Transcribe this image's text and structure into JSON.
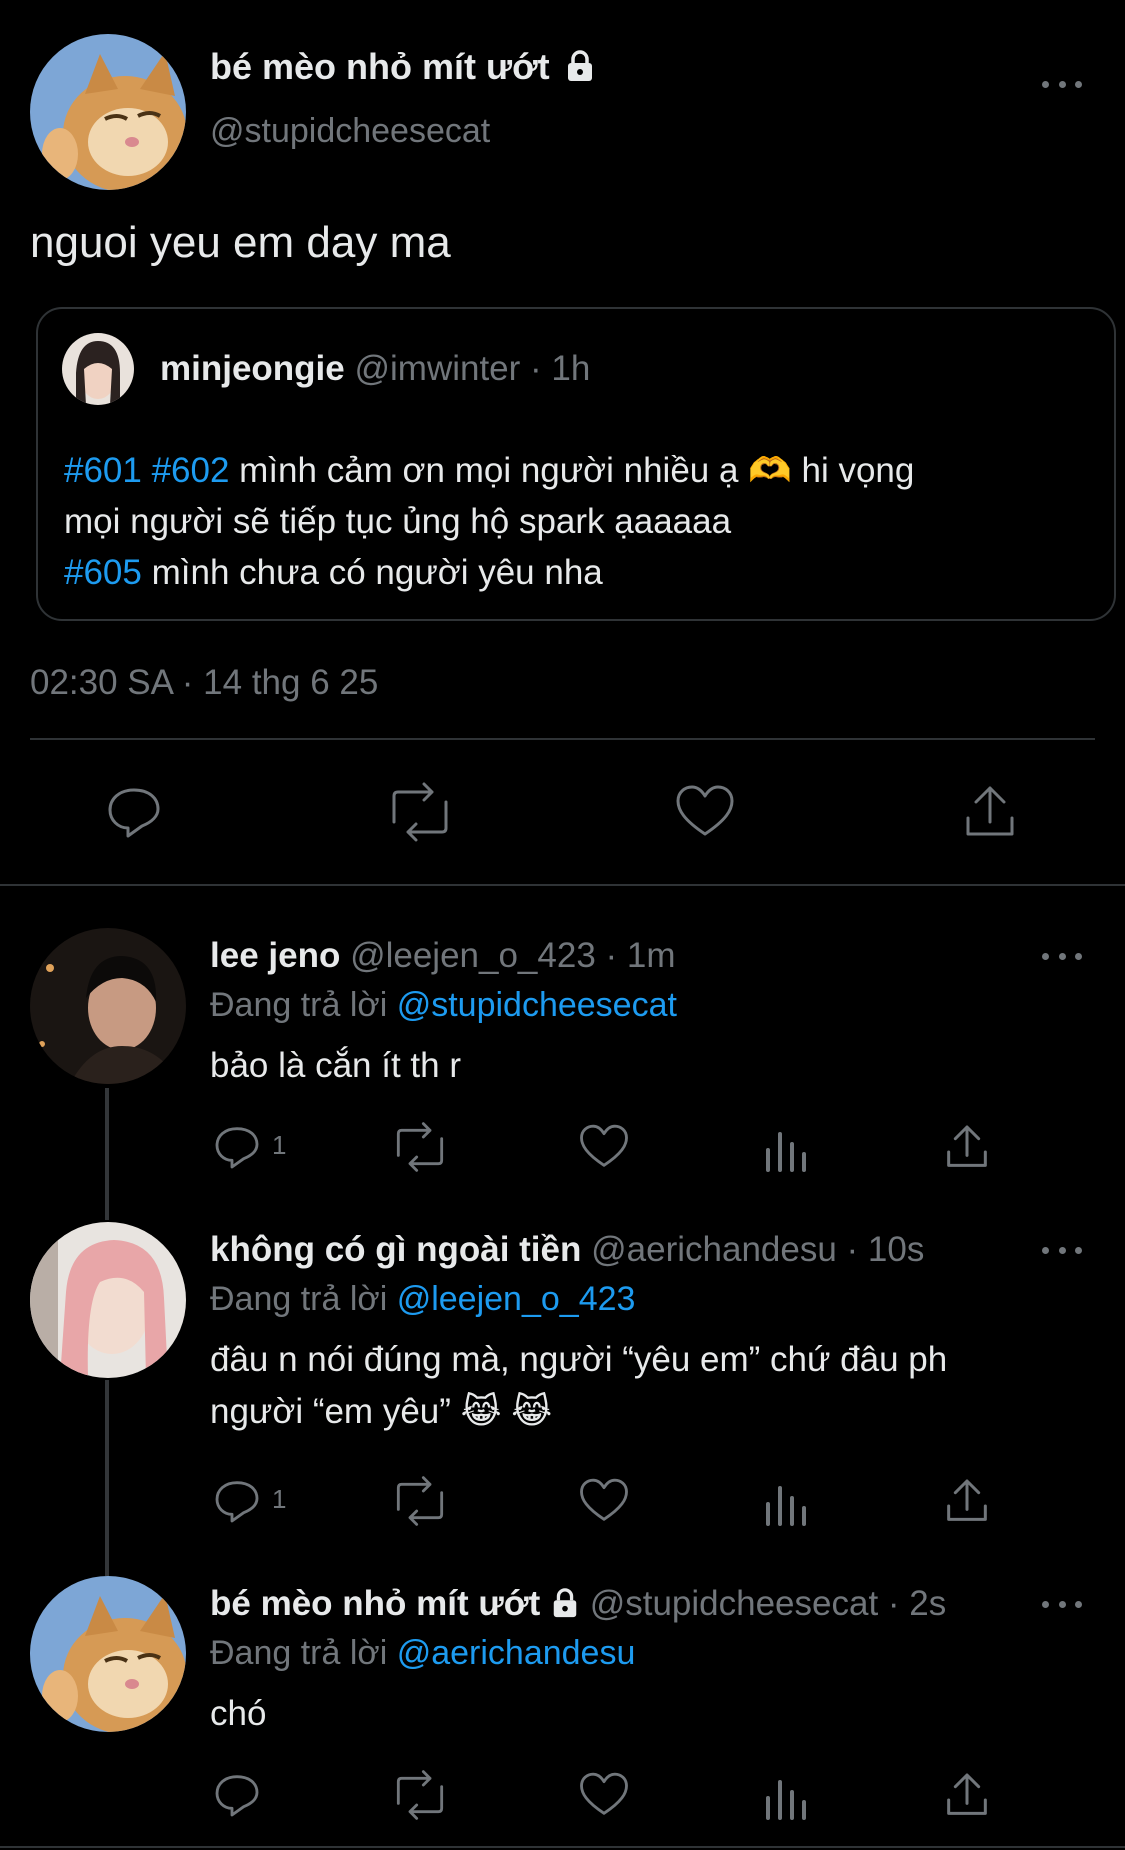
{
  "main_tweet": {
    "display_name": "bé mèo nhỏ mít ướt",
    "handle": "@stupidcheesecat",
    "text": "nguoi yeu em day ma",
    "timestamp": "02:30 SA · 14 thg 6 25",
    "quoted": {
      "display_name": "minjeongie",
      "handle": "@imwinter",
      "time": "· 1h",
      "line1_tags": "#601 #602",
      "line1_text": " mình cảm ơn mọi người nhiều ạ 🫶  hi vọng",
      "line2_text": "mọi người sẽ tiếp tục ủng hộ spark ạaaaaa",
      "line3_tag": "#605",
      "line3_text": " mình chưa có người yêu nha"
    }
  },
  "replies": [
    {
      "display_name": "lee jeno",
      "handle": "@leejen_o_423",
      "time": "· 1m",
      "replying_prefix": "Đang trả lời ",
      "replying_to": "@stupidcheesecat",
      "text": "bảo là cắn ít th r",
      "reply_count": "1"
    },
    {
      "display_name": "không có gì ngoài tiền",
      "handle": "@aerichandesu",
      "time": "· 10s",
      "replying_prefix": "Đang trả lời ",
      "replying_to": "@leejen_o_423",
      "text_line1": "đâu n nói đúng mà, người “yêu em” chứ đâu ph",
      "text_line2": "người “em yêu” 😹 😹",
      "reply_count": "1"
    },
    {
      "display_name": "bé mèo nhỏ mít ướt",
      "handle": "@stupidcheesecat",
      "time": "· 2s",
      "replying_prefix": "Đang trả lời ",
      "replying_to": "@aerichandesu",
      "text": "chó"
    }
  ],
  "icons": [
    "lock-icon",
    "more-icon",
    "reply-icon",
    "retweet-icon",
    "like-icon",
    "views-icon",
    "share-icon"
  ],
  "colors": {
    "background": "#000000",
    "link": "#1d9bf0",
    "muted": "#71767b",
    "text": "#e7e9ea"
  }
}
